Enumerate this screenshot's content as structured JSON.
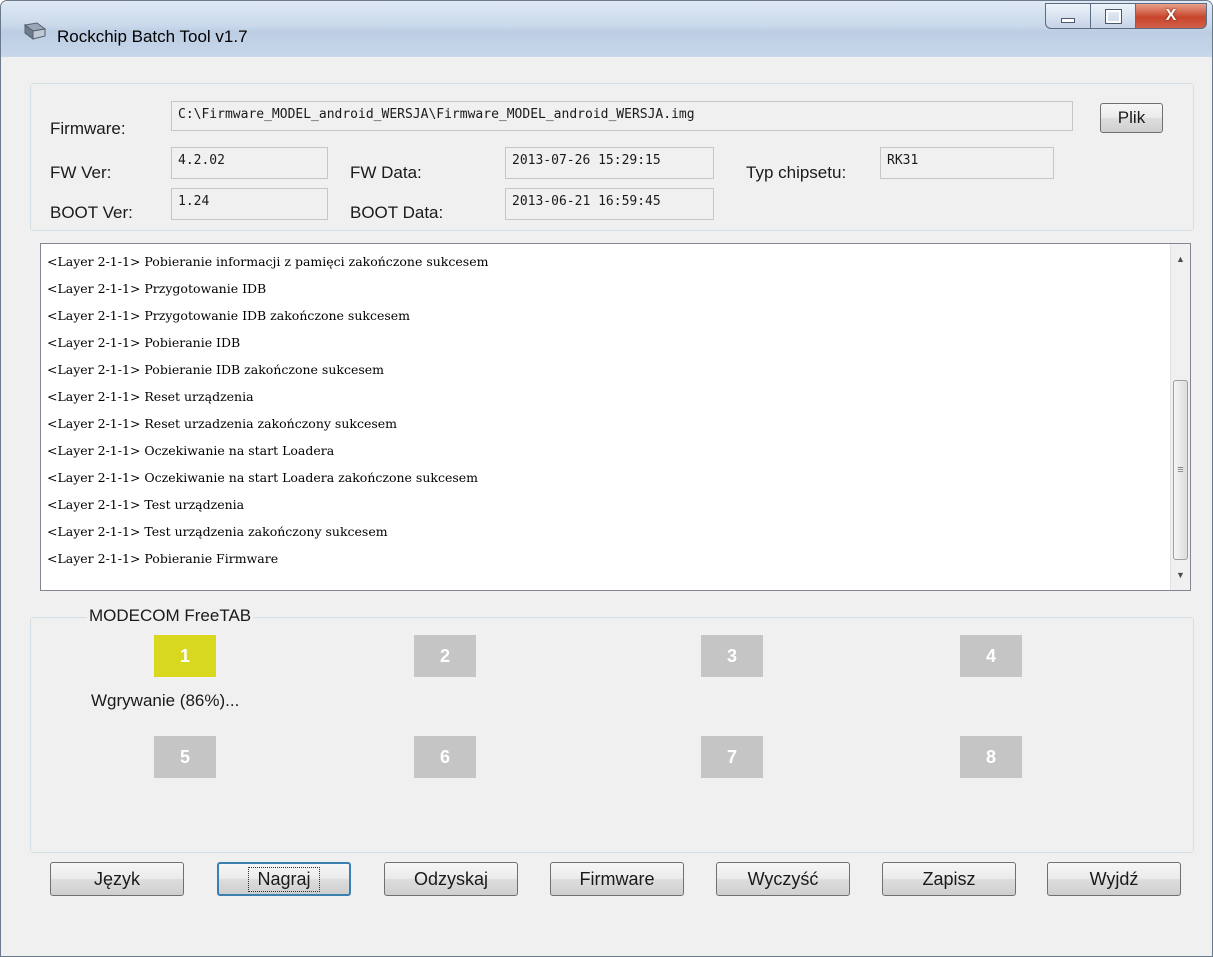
{
  "window": {
    "title": "Rockchip Batch Tool v1.7",
    "close_glyph": "X",
    "colors": {
      "active_slot": "#d8d81e",
      "idle_slot": "#c5c5c5",
      "close_button": "#c7452b"
    }
  },
  "firmware": {
    "label": "Firmware:",
    "path": "C:\\Firmware_MODEL_android_WERSJA\\Firmware_MODEL_android_WERSJA.img",
    "browse_button": "Plik",
    "fw_ver_label": "FW Ver:",
    "fw_ver": "4.2.02",
    "fw_date_label": "FW Data:",
    "fw_date": "2013-07-26 15:29:15",
    "chip_label": "Typ chipsetu:",
    "chip": "RK31",
    "boot_ver_label": "BOOT Ver:",
    "boot_ver": "1.24",
    "boot_date_label": "BOOT Data:",
    "boot_date": "2013-06-21 16:59:45"
  },
  "log": [
    "<Layer 2-1-1> Pobieranie informacji z pamięci zakończone sukcesem",
    "<Layer 2-1-1> Przygotowanie IDB",
    "<Layer 2-1-1> Przygotowanie IDB zakończone sukcesem",
    "<Layer 2-1-1> Pobieranie IDB",
    "<Layer 2-1-1> Pobieranie IDB zakończone sukcesem",
    "<Layer 2-1-1> Reset urządzenia",
    "<Layer 2-1-1> Reset urzadzenia zakończony sukcesem",
    "<Layer 2-1-1> Oczekiwanie na start Loadera",
    "<Layer 2-1-1> Oczekiwanie na start Loadera zakończone sukcesem",
    "<Layer 2-1-1> Test urządzenia",
    "<Layer 2-1-1> Test urządzenia zakończony sukcesem",
    "<Layer 2-1-1> Pobieranie Firmware"
  ],
  "devices": {
    "group_label": "MODECOM FreeTAB",
    "slots": [
      "1",
      "2",
      "3",
      "4",
      "5",
      "6",
      "7",
      "8"
    ],
    "active_slot": "1",
    "status": "Wgrywanie (86%)..."
  },
  "buttons": {
    "language": "Język",
    "upgrade": "Nagraj",
    "restore": "Odzyskaj",
    "firmware": "Firmware",
    "clear": "Wyczyść",
    "save": "Zapisz",
    "exit": "Wyjdź"
  }
}
